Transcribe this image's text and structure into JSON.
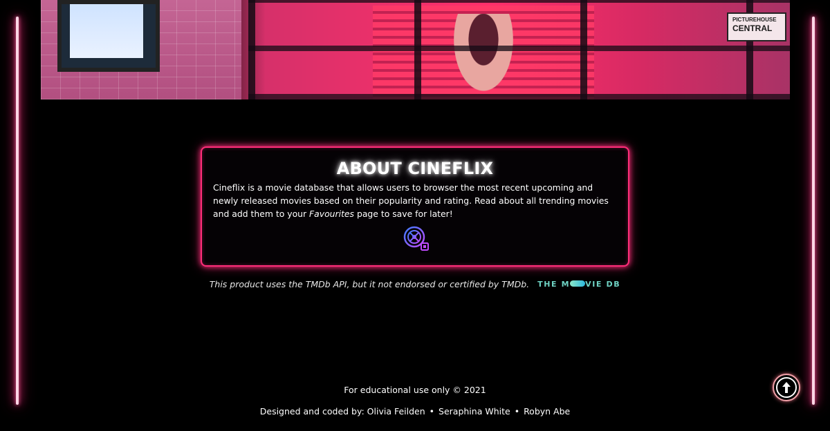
{
  "about": {
    "title": "ABOUT CINEFLIX",
    "text_part1": "Cineflix is a movie database that allows users to browser the most recent upcoming and newly released movies based on their popularity and rating. Read about all trending movies and add them to your ",
    "favourites_link": "Favourites",
    "text_part2": " page to save for later!"
  },
  "hero": {
    "sign_line1": "PICTUREHOUSE",
    "sign_line2": "CENTRAL"
  },
  "tmdb": {
    "notice": "This product uses the TMDb API, but it not endorsed or certified by TMDb.",
    "logo_left": "THE M",
    "logo_right": "VIE DB"
  },
  "footer": {
    "edu": "For educational use only © 2021",
    "credits_prefix": "Designed and coded by:",
    "authors": [
      "Olivia Feilden",
      "Seraphina White",
      "Robyn Abe"
    ],
    "separator": "•"
  },
  "colors": {
    "neon_pink": "#ff2d7a",
    "tmdb_teal": "#6fd3c4"
  },
  "icons": {
    "about_logo": "film-reel-icon",
    "scroll_top": "arrow-up-icon"
  }
}
